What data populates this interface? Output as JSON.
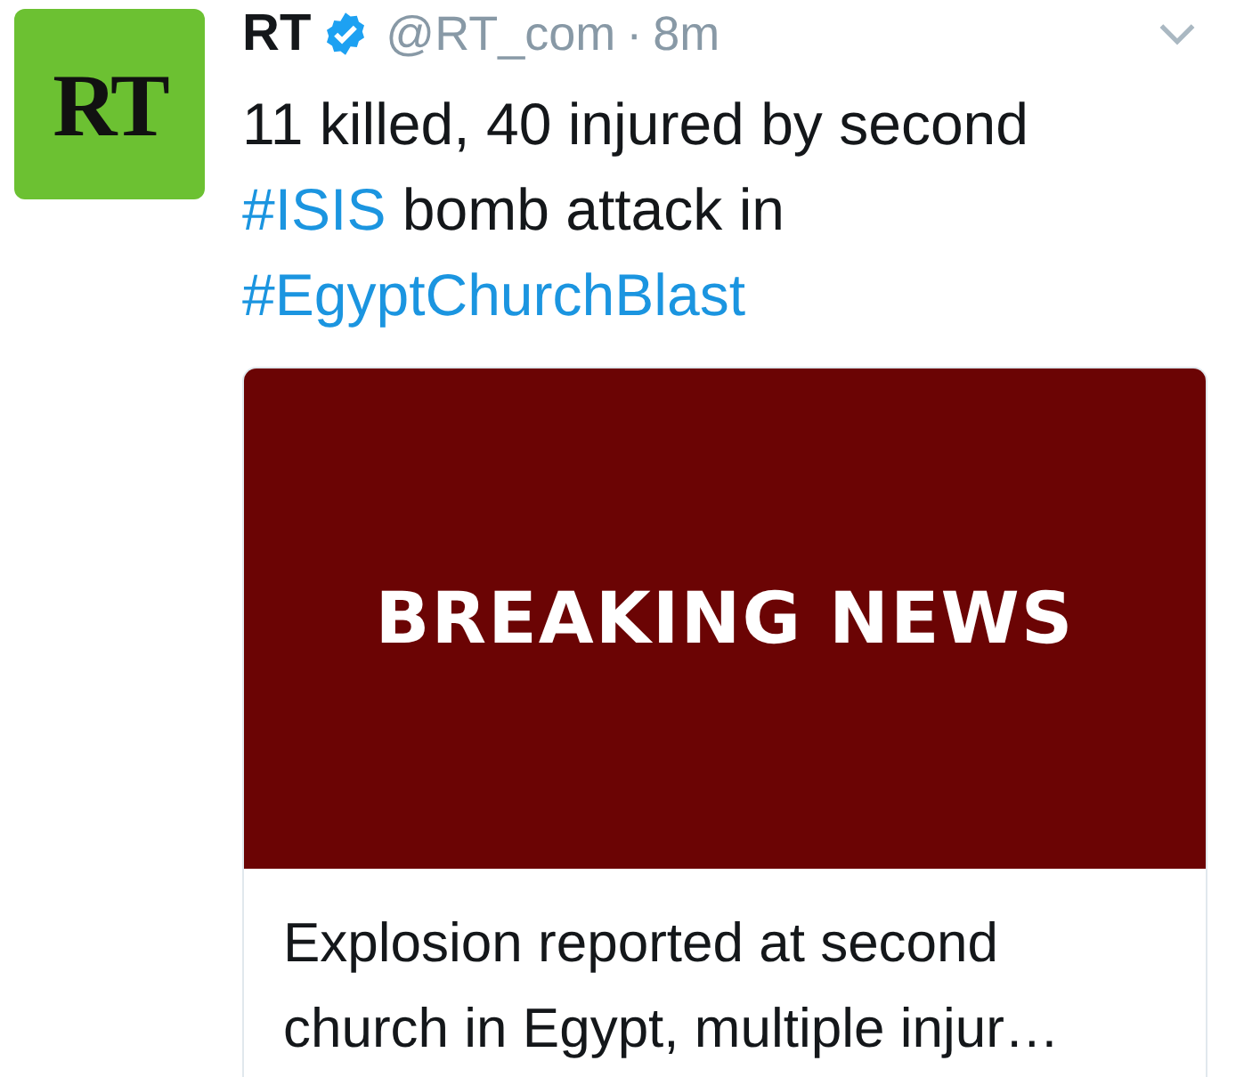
{
  "tweet": {
    "avatar_text": "RT",
    "name": "RT",
    "verified": true,
    "handle": "@RT_com",
    "separator": "·",
    "time": "8m",
    "text": [
      {
        "kind": "plain",
        "text": "11 killed, 40 injured by second "
      },
      {
        "kind": "hashtag",
        "text": "#ISIS"
      },
      {
        "kind": "plain",
        "text": " bomb attack in "
      },
      {
        "kind": "hashtag",
        "text": "#EgyptChurchBlast"
      }
    ],
    "card": {
      "image_text": "BREAKING NEWS",
      "title": "Explosion reported at second church in Egypt, multiple injur…"
    }
  }
}
